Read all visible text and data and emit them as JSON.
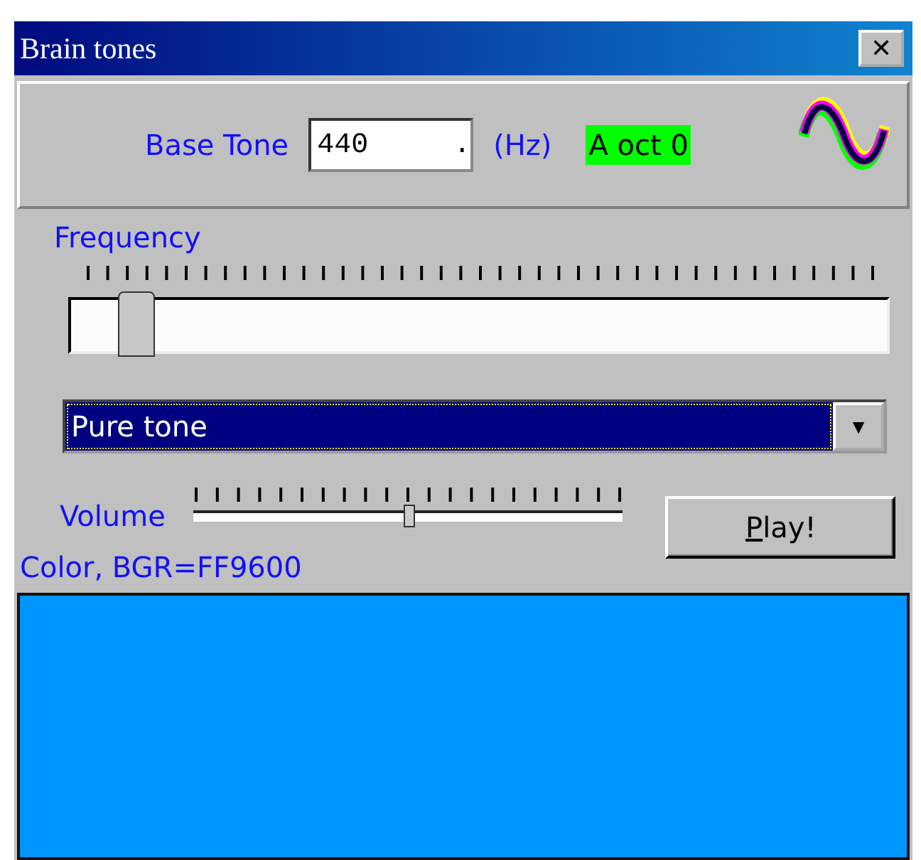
{
  "window": {
    "title": "Brain tones",
    "close": "✕"
  },
  "base_tone": {
    "label": "Base Tone",
    "value": "440     .",
    "unit": "(Hz)",
    "note": "A oct 0"
  },
  "frequency": {
    "label": "Frequency",
    "level": 0.08
  },
  "waveform": {
    "value": "Pure tone",
    "arrow": "▼"
  },
  "volume": {
    "label": "Volume",
    "level": 0.5
  },
  "play_button": "Play!",
  "color": {
    "label": "Color, BGR=FF9600",
    "color": "#0096ff"
  }
}
